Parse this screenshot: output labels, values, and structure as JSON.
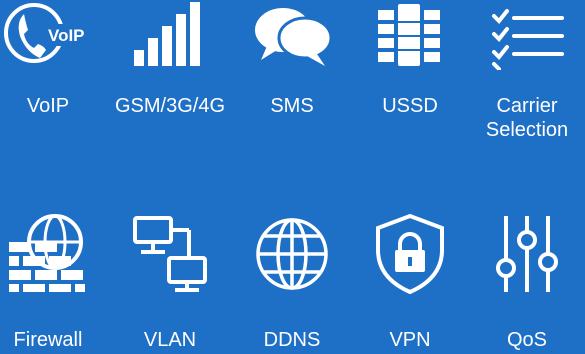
{
  "colors": {
    "background": "#1e6fc6",
    "foreground": "#ffffff"
  },
  "features": [
    {
      "label": "VoIP",
      "icon": "voip-phone-icon",
      "badge": "VoIP"
    },
    {
      "label": "GSM/3G/4G",
      "icon": "signal-bars-icon"
    },
    {
      "label": "SMS",
      "icon": "chat-bubbles-icon"
    },
    {
      "label": "USSD",
      "icon": "keypad-grid-icon"
    },
    {
      "label": "Carrier\nSelection",
      "icon": "checklist-icon"
    },
    {
      "label": "Firewall",
      "icon": "brick-wall-globe-icon"
    },
    {
      "label": "VLAN",
      "icon": "network-monitors-icon"
    },
    {
      "label": "DDNS",
      "icon": "globe-icon"
    },
    {
      "label": "VPN",
      "icon": "shield-lock-icon"
    },
    {
      "label": "QoS",
      "icon": "sliders-icon"
    }
  ]
}
